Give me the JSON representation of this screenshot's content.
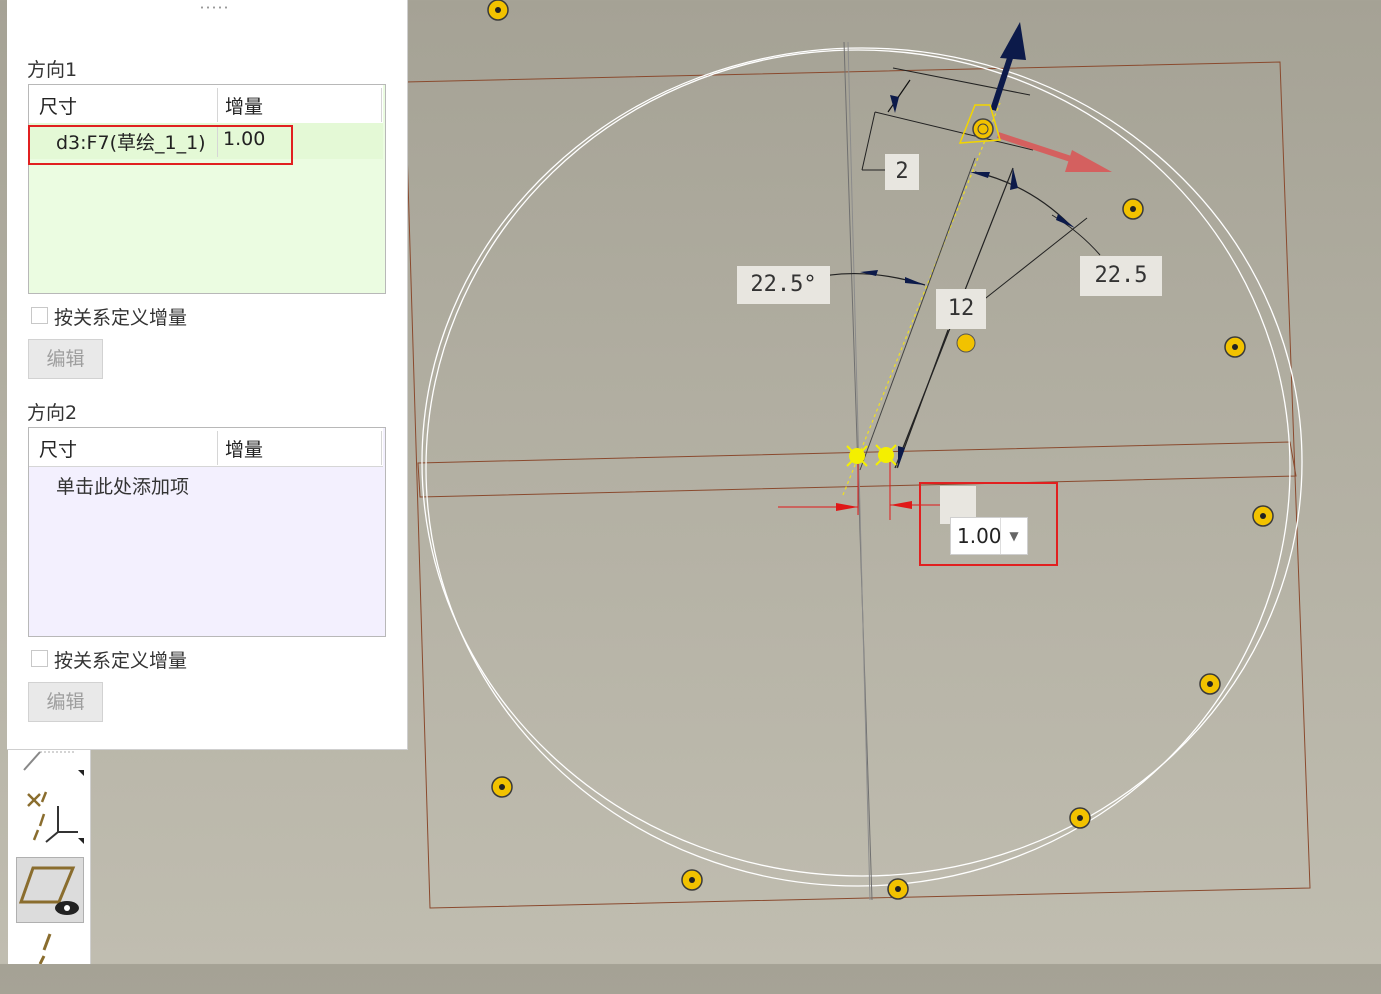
{
  "panel": {
    "direction1": {
      "title": "方向1",
      "col_dimension": "尺寸",
      "col_increment": "增量",
      "rows": [
        {
          "dimension": "d3:F7(草绘_1_1)",
          "increment": "1.00"
        }
      ],
      "relation_checkbox": "按关系定义增量",
      "relation_checked": false,
      "edit_button": "编辑"
    },
    "direction2": {
      "title": "方向2",
      "col_dimension": "尺寸",
      "col_increment": "增量",
      "placeholder": "单击此处添加项",
      "relation_checkbox": "按关系定义增量",
      "relation_checked": false,
      "edit_button": "编辑"
    }
  },
  "graphics": {
    "dimensions": {
      "d_small": "2",
      "d_angle_left": "22.5°",
      "d_angle_right": "22.5",
      "d_length": "12"
    },
    "increment_input": {
      "value": "1.00"
    }
  },
  "icons": [
    "plane-icon",
    "csys-icon",
    "plane-display-icon",
    "axis-icon",
    "dropdown-arrow-icon"
  ],
  "colors": {
    "highlight": "#e12020",
    "direction1_bg": "#ebfce1",
    "direction2_bg": "#f3f0fe",
    "drag_handle": "#f2c200",
    "arrow_dark": "#0c1a4a",
    "arrow_red": "#d4605f"
  }
}
